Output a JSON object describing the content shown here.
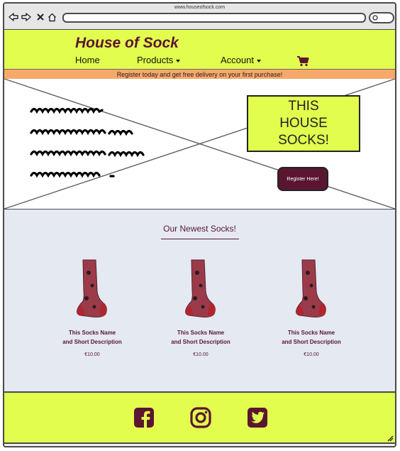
{
  "browser": {
    "url": "www.houseofsock.com",
    "icons": [
      "back-arrow-icon",
      "forward-arrow-icon",
      "close-icon",
      "home-icon",
      "search-icon"
    ]
  },
  "header": {
    "brand": "House of Sock",
    "nav": [
      {
        "label": "Home",
        "dropdown": false
      },
      {
        "label": "Products",
        "dropdown": true
      },
      {
        "label": "Account",
        "dropdown": true
      }
    ],
    "cart_icon": "cart-icon"
  },
  "promo": {
    "text": "Register today and get free delivery on your first purchase!"
  },
  "hero": {
    "callout_lines": [
      "THIS",
      "HOUSE",
      "SOCKS!"
    ],
    "register_label": "Register Here!"
  },
  "products": {
    "title": "Our Newest Socks!",
    "items": [
      {
        "name": "This Socks Name\nand Short Description",
        "price": "€10.00"
      },
      {
        "name": "This Socks Name\nand Short Description",
        "price": "€10.00"
      },
      {
        "name": "This Socks Name\nand Short Description",
        "price": "€10.00"
      }
    ]
  },
  "footer": {
    "social_icons": [
      "facebook-icon",
      "instagram-icon",
      "twitter-icon"
    ]
  },
  "colors": {
    "accent_yellow": "#e2fd4d",
    "brand_maroon": "#5a1630",
    "promo_orange": "#f6a96a",
    "section_bg": "#e4e9f2"
  }
}
